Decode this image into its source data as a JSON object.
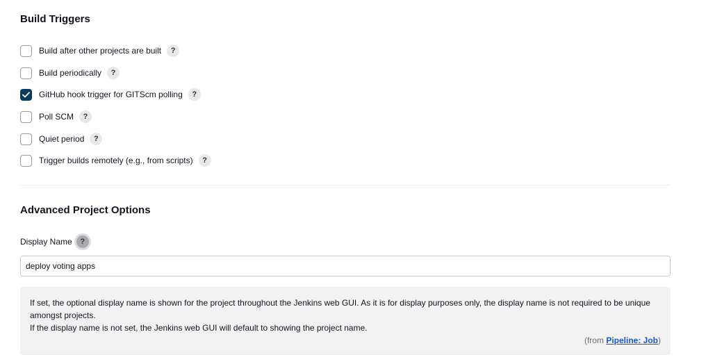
{
  "build_triggers": {
    "title": "Build Triggers",
    "items": [
      {
        "label": "Build after other projects are built",
        "checked": false
      },
      {
        "label": "Build periodically",
        "checked": false
      },
      {
        "label": "GitHub hook trigger for GITScm polling",
        "checked": true
      },
      {
        "label": "Poll SCM",
        "checked": false
      },
      {
        "label": "Quiet period",
        "checked": false
      },
      {
        "label": "Trigger builds remotely (e.g., from scripts)",
        "checked": false
      }
    ],
    "help_glyph": "?"
  },
  "advanced_options": {
    "title": "Advanced Project Options",
    "display_name": {
      "label": "Display Name",
      "value": "deploy voting apps",
      "help_glyph": "?"
    },
    "help_panel": {
      "paragraph_1": "If set, the optional display name is shown for the project throughout the Jenkins web GUI. As it is for display purposes only, the display name is not required to be unique amongst projects.",
      "paragraph_2": "If the display name is not set, the Jenkins web GUI will default to showing the project name.",
      "source_prefix": "(from ",
      "source_link": "Pipeline: Job",
      "source_suffix": ")"
    }
  },
  "colors": {
    "checkbox_checked": "#0b3b5c",
    "link": "#1a57c9",
    "panel_bg": "#f2f2f3"
  }
}
